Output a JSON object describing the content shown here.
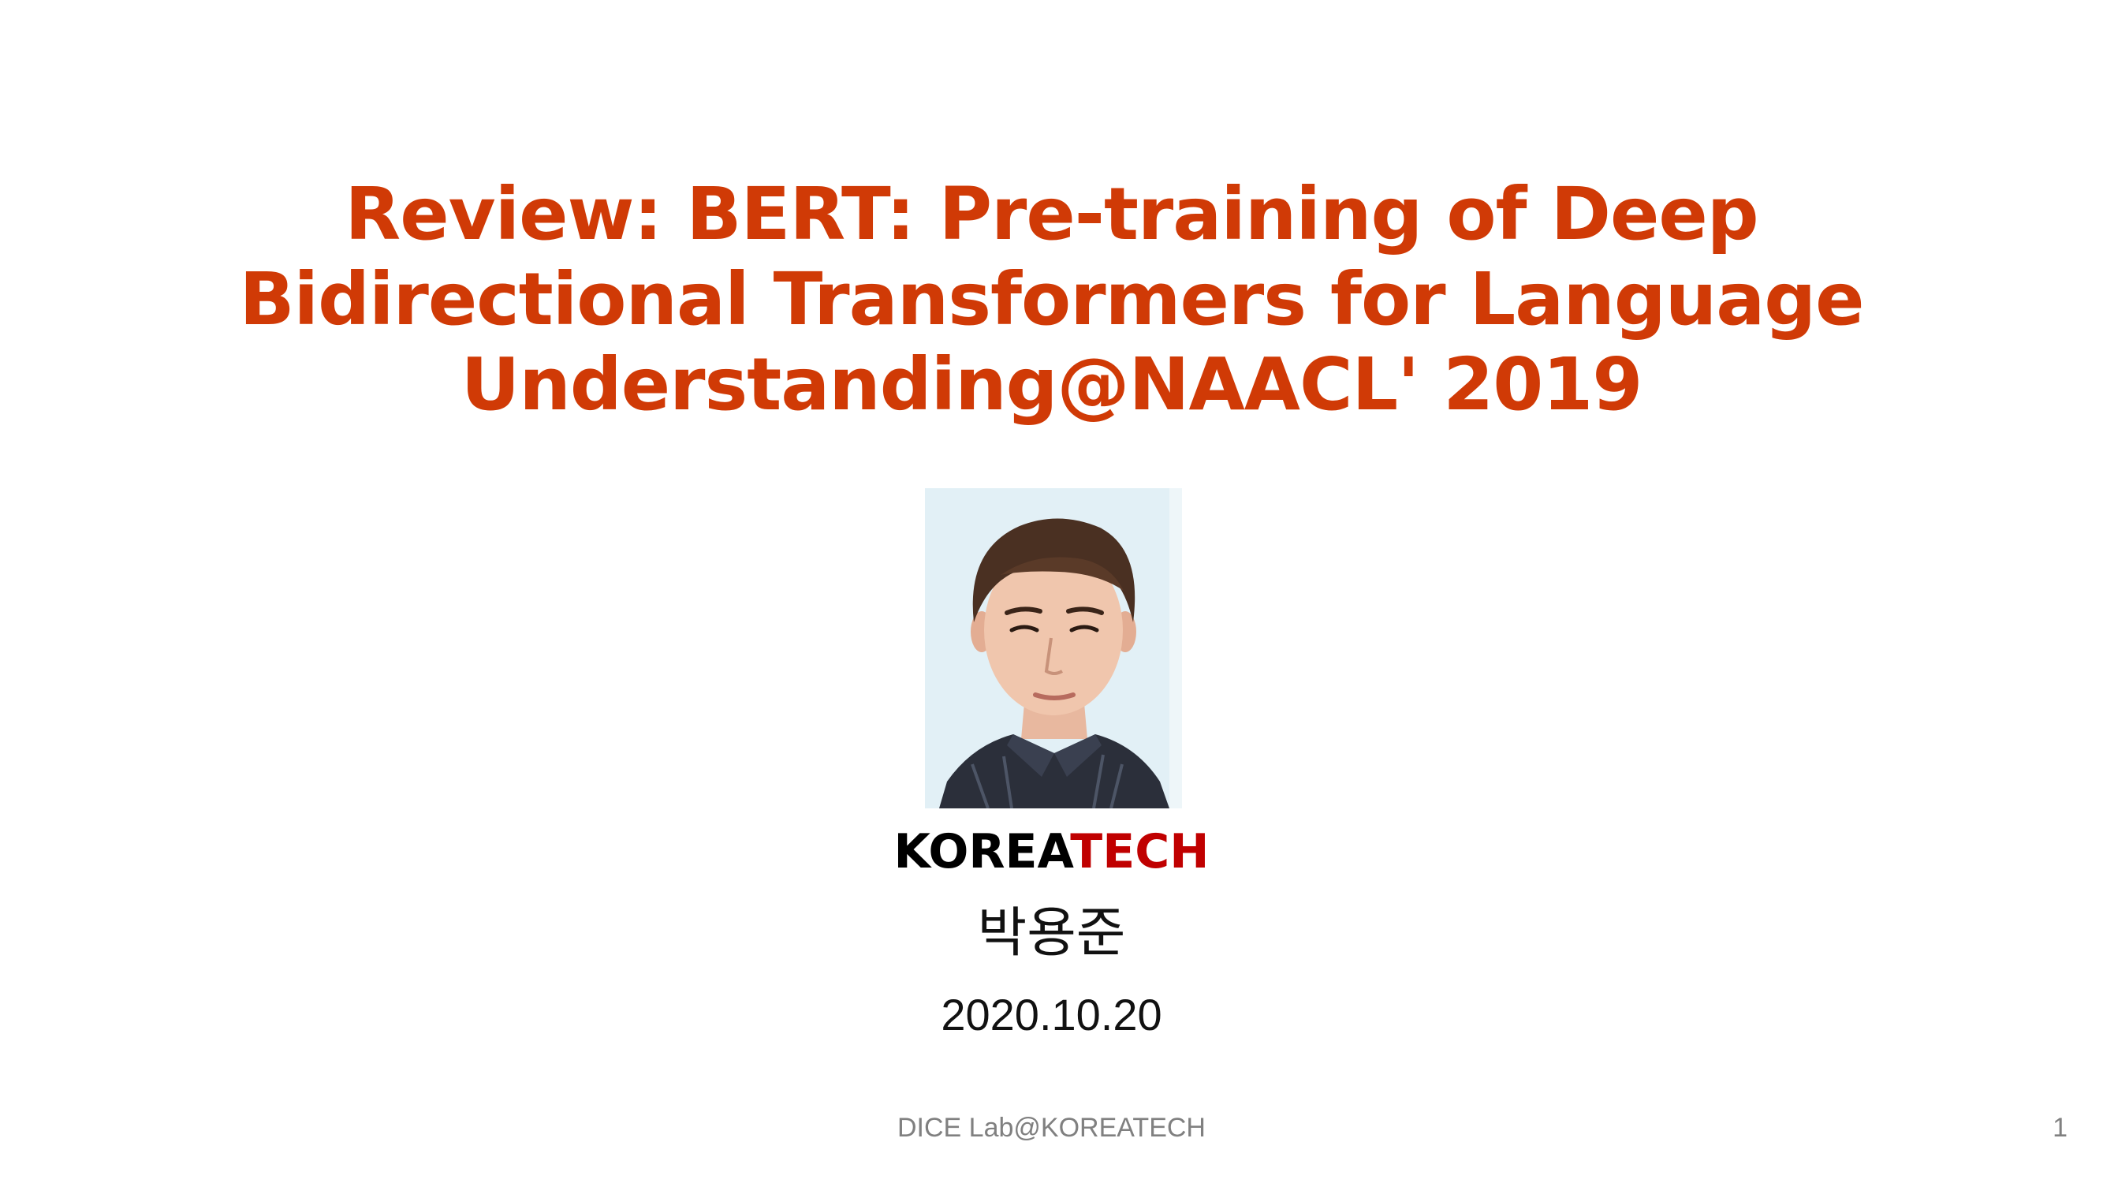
{
  "colors": {
    "title": "#d03a06",
    "institution_primary": "#000000",
    "institution_accent": "#c00000",
    "body_text": "#111111",
    "footer_text": "#808080"
  },
  "slide": {
    "title_lines": [
      "Review: BERT: Pre-training of Deep",
      "Bidirectional Transformers for Language",
      "Understanding@NAACL' 2019"
    ],
    "institution": {
      "part1": "KOREA",
      "part2": "TECH"
    },
    "author": "박용준",
    "date": "2020.10.20",
    "footer": "DICE  Lab@KOREATECH",
    "page_number": "1"
  }
}
